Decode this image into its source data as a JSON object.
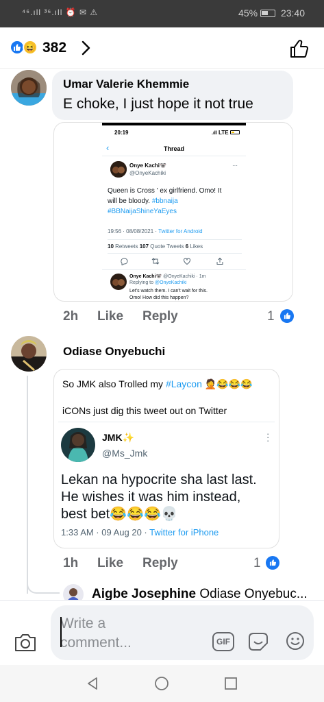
{
  "status_bar": {
    "left_icons": "⁴⁶.ıll ³⁶.ıll ⏰ ✉ ⚠",
    "battery": "45%",
    "time": "23:40"
  },
  "header": {
    "reaction_count": "382",
    "reaction_icons": [
      "like-icon",
      "haha-icon"
    ]
  },
  "comments": [
    {
      "author": "Umar Valerie Khemmie",
      "text": "E choke, I just hope it not true",
      "time": "2h",
      "like_label": "Like",
      "reply_label": "Reply",
      "likes": "1",
      "attachment": {
        "status_time": "20:19",
        "status_net": "LTE",
        "thread_title": "Thread",
        "tweet_author": "Onye Kachi🐨",
        "tweet_handle": "@OnyeKachiki",
        "tweet_text_1": "Queen is Cross ' ex girlfriend. Omo! It",
        "tweet_text_2": "will be bloody.",
        "tweet_tag_1": "#bbnaija",
        "tweet_tag_2": "#BBNaijaShineYaEyes",
        "tweet_meta": "19:56 · 08/08/2021 · ",
        "tweet_client": "Twitter for Android",
        "retweets_num": "10",
        "retweets_label": " Retweets  ",
        "quotes_num": "107",
        "quotes_label": " Quote Tweets  ",
        "likes_num": "6",
        "likes_label": " Likes",
        "reply_author": "Onye Kachi🐨",
        "reply_handle": " @OnyeKachiki · 1m",
        "replying_to": "Replying to ",
        "replying_handle": "@OnyeKachiki",
        "reply_text_1": "Let's watch them. I can't wait for this.",
        "reply_text_2": "Omo! How did this happen?"
      }
    },
    {
      "author": "Odiase Onyebuchi",
      "time": "1h",
      "like_label": "Like",
      "reply_label": "Reply",
      "likes": "1",
      "attachment": {
        "line1_prefix": "So JMK also Trolled my ",
        "line1_tag": "#Laycon",
        "line1_emoji": " 🤦😂😂😂",
        "line2": "iCONs just dig this tweet out on Twitter",
        "quoted_name": "JMK✨",
        "quoted_handle": "@Ms_Jmk",
        "quoted_text_1": "Lekan na hypocrite sha last last.",
        "quoted_text_2": "He wishes it was him instead,",
        "quoted_text_3": "best bet😂😂😂💀",
        "quoted_meta": "1:33 AM · 09 Aug 20 · ",
        "quoted_client": "Twitter for iPhone"
      }
    }
  ],
  "reply_preview": {
    "author": "Aigbe Josephine",
    "text": "Odiase Onyebuc..."
  },
  "composer": {
    "placeholder_1": "Write a",
    "placeholder_2": "comment...",
    "gif_label": "GIF"
  },
  "colors": {
    "accent": "#1877f2",
    "twitter_blue": "#1d9bf0",
    "bubble": "#f0f2f5",
    "meta_grey": "#65676b"
  }
}
